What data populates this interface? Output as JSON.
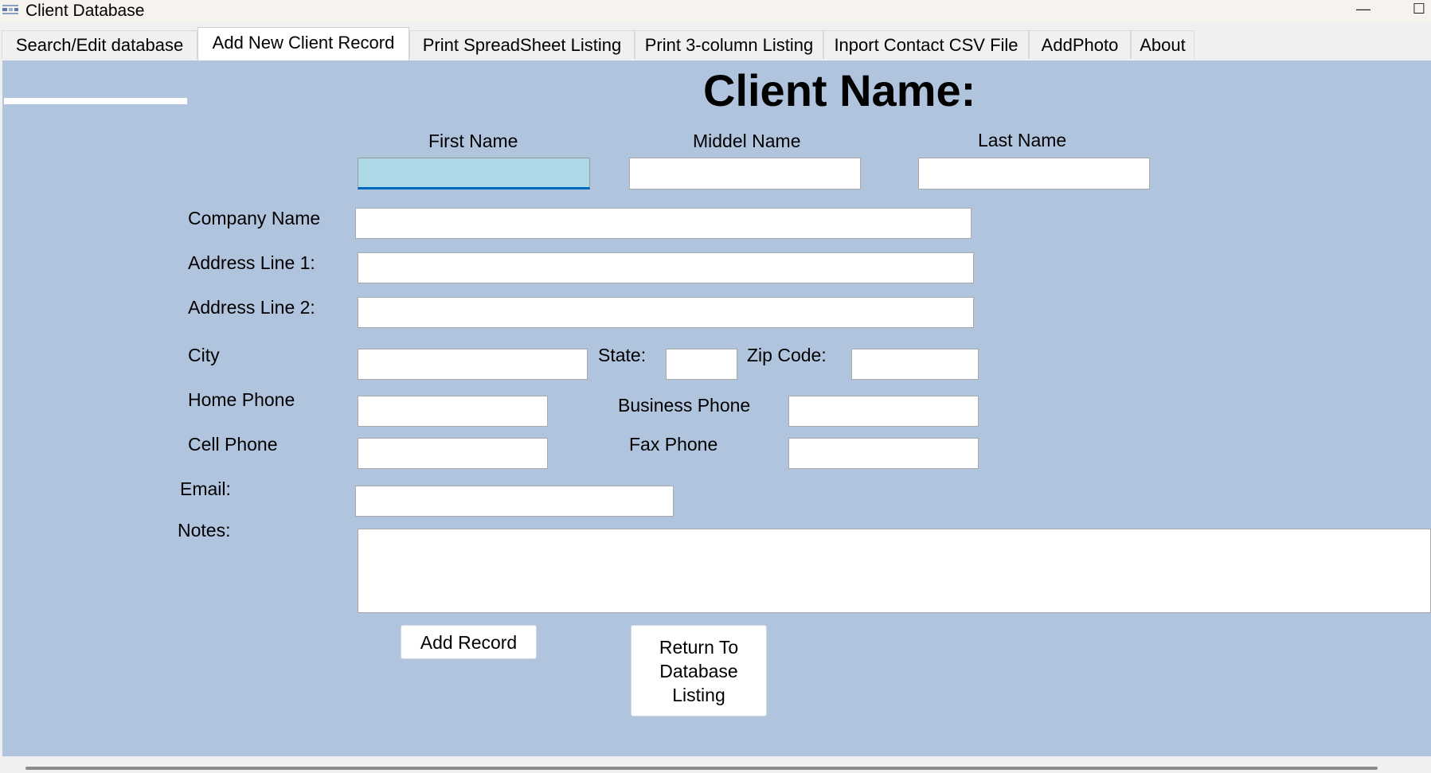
{
  "window": {
    "title": "Client Database",
    "minimize_glyph": "—",
    "maximize_glyph": "☐"
  },
  "tabs": [
    {
      "label": "Search/Edit database",
      "active": false
    },
    {
      "label": "Add New Client Record",
      "active": true
    },
    {
      "label": "Print SpreadSheet Listing",
      "active": false
    },
    {
      "label": "Print 3-column Listing",
      "active": false
    },
    {
      "label": "Inport Contact CSV File",
      "active": false
    },
    {
      "label": "AddPhoto",
      "active": false
    },
    {
      "label": "About",
      "active": false
    }
  ],
  "form": {
    "title": "Client Name:",
    "labels": {
      "first_name": "First Name",
      "middle_name": "Middel Name",
      "last_name": "Last Name",
      "company_name": "Company Name",
      "address1": "Address Line 1:",
      "address2": "Address Line 2:",
      "city": "City",
      "state": "State:",
      "zip": "Zip Code:",
      "home_phone": "Home Phone",
      "business_phone": "Business Phone",
      "cell_phone": "Cell Phone",
      "fax_phone": "Fax Phone",
      "email": "Email:",
      "notes": "Notes:"
    },
    "values": {
      "first_name": "",
      "middle_name": "",
      "last_name": "",
      "company_name": "",
      "address1": "",
      "address2": "",
      "city": "",
      "state": "",
      "zip": "",
      "home_phone": "",
      "business_phone": "",
      "cell_phone": "",
      "fax_phone": "",
      "email": "",
      "notes": ""
    },
    "buttons": {
      "add_record": "Add Record",
      "return_line1": "Return To",
      "return_line2": "Database",
      "return_line3": "Listing"
    }
  },
  "colors": {
    "panel_background": "#b0c4de",
    "focused_field": "#add8e6",
    "focus_underline": "#0067c0"
  }
}
